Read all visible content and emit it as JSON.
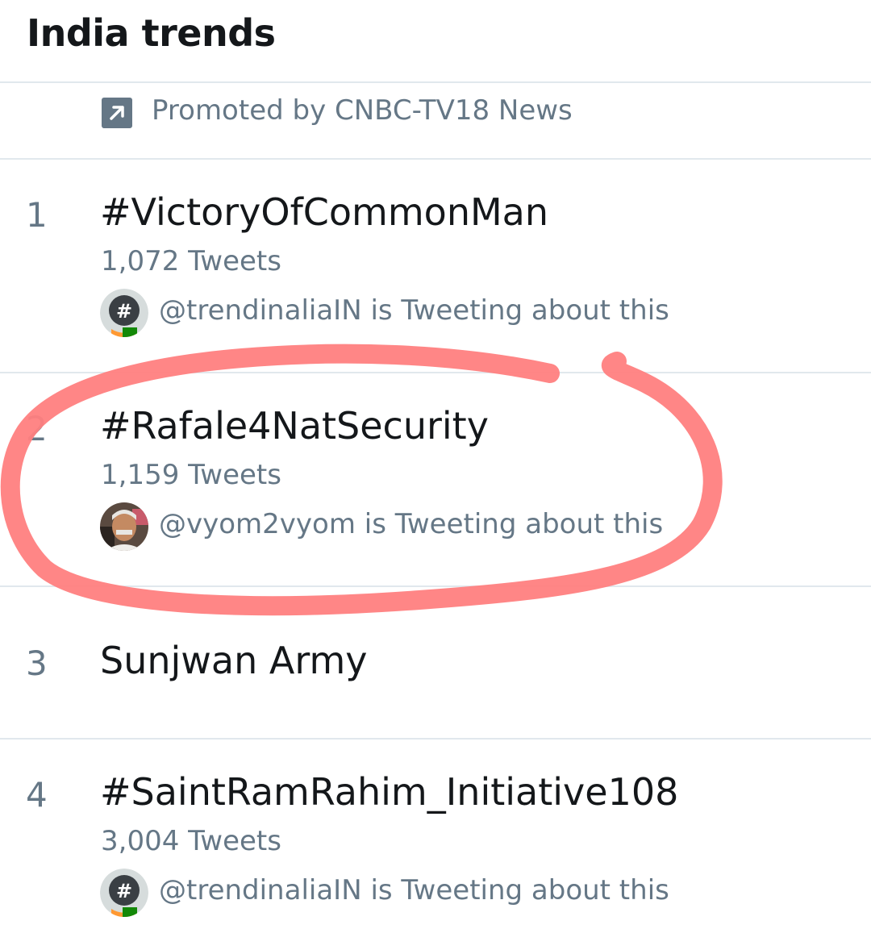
{
  "header": {
    "title": "India trends"
  },
  "promoted": {
    "text": "Promoted by CNBC-TV18 News",
    "icon": "promoted-arrow-icon"
  },
  "trends": [
    {
      "rank": "1",
      "name": "#VictoryOfCommonMan",
      "count": "1,072 Tweets",
      "context": "@trendinaliaIN is Tweeting about this",
      "avatar": "trendinalia-hashtag-avatar"
    },
    {
      "rank": "2",
      "name": "#Rafale4NatSecurity",
      "count": "1,159 Tweets",
      "context": "@vyom2vyom is Tweeting about this",
      "avatar": "user-photo-avatar"
    },
    {
      "rank": "3",
      "name": "Sunjwan Army"
    },
    {
      "rank": "4",
      "name": "#SaintRamRahim_Initiative108",
      "count": "3,004 Tweets",
      "context": "@trendinaliaIN is Tweeting about this",
      "avatar": "trendinalia-hashtag-avatar"
    }
  ],
  "colors": {
    "primary_text": "#14171a",
    "secondary_text": "#657786",
    "divider": "#e1e8ed",
    "annotation": "#ff7f7f"
  }
}
